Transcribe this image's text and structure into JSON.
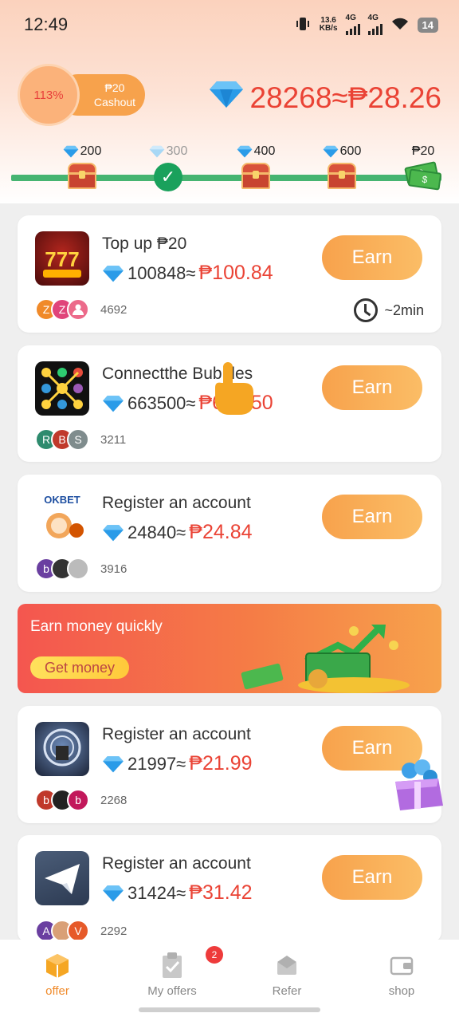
{
  "status_bar": {
    "time": "12:49",
    "speed_top": "13.6",
    "speed_bottom": "KB/s",
    "net1": "4G",
    "net2": "4G",
    "battery": "14"
  },
  "header": {
    "progress_percent": "113%",
    "cashout_amount": "₱20",
    "cashout_label": "Cashout",
    "balance_text": "28268≈₱28.26"
  },
  "milestones": [
    {
      "label": "200",
      "state": "chest"
    },
    {
      "label": "300",
      "state": "done"
    },
    {
      "label": "400",
      "state": "chest"
    },
    {
      "label": "600",
      "state": "chest"
    },
    {
      "label": "₱20",
      "state": "cash"
    }
  ],
  "offers": [
    {
      "title": "Top up ₱20",
      "diamonds": "100848≈",
      "peso": "₱100.84",
      "button": "Earn",
      "avatars": [
        {
          "t": "Z",
          "c": "#f08a2a"
        },
        {
          "t": "Z",
          "c": "#e0447a"
        },
        {
          "t": "",
          "c": "#ec6a8a"
        }
      ],
      "count": "4692",
      "duration": "~2min"
    },
    {
      "title": "Connectthe Bubbles",
      "diamonds": "663500≈",
      "peso": "₱663.50",
      "button": "Earn",
      "avatars": [
        {
          "t": "R",
          "c": "#2e8b6e"
        },
        {
          "t": "B",
          "c": "#c0392b"
        },
        {
          "t": "S",
          "c": "#7f8c8d"
        }
      ],
      "count": "3211"
    },
    {
      "title": "Register an account",
      "diamonds": "24840≈",
      "peso": "₱24.84",
      "button": "Earn",
      "avatars": [
        {
          "t": "b",
          "c": "#6a3fa0"
        },
        {
          "t": "",
          "c": "#333333"
        },
        {
          "t": "",
          "c": "#bbbbbb"
        }
      ],
      "count": "3916"
    },
    {
      "title": "Register an account",
      "diamonds": "21997≈",
      "peso": "₱21.99",
      "button": "Earn",
      "avatars": [
        {
          "t": "b",
          "c": "#c0392b"
        },
        {
          "t": "",
          "c": "#222222"
        },
        {
          "t": "b",
          "c": "#c2185b"
        }
      ],
      "count": "2268"
    },
    {
      "title": "Register an account",
      "diamonds": "31424≈",
      "peso": "₱31.42",
      "button": "Earn",
      "avatars": [
        {
          "t": "A",
          "c": "#6a3fa0"
        },
        {
          "t": "",
          "c": "#d9a077"
        },
        {
          "t": "V",
          "c": "#e65a2a"
        }
      ],
      "count": "2292"
    }
  ],
  "banner": {
    "text": "Earn money quickly",
    "button": "Get money"
  },
  "nav": {
    "items": [
      "offer",
      "My offers",
      "Refer",
      "shop"
    ],
    "badge": "2"
  },
  "colors": {
    "accent": "#f7a24c",
    "price_red": "#ea4335",
    "progress_green": "#46b471"
  }
}
